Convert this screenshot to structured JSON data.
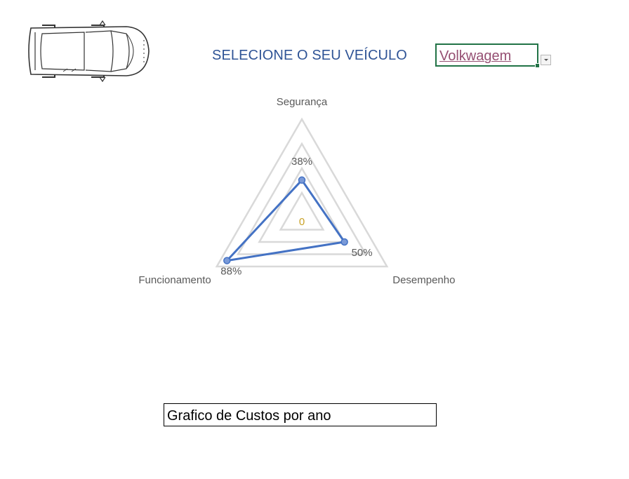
{
  "header": {
    "title": "SELECIONE O SEU VEÍCULO",
    "selected_vehicle": "Volkwagem"
  },
  "icons": {
    "car": "car-top-view-icon",
    "dropdown": "chevron-down-icon"
  },
  "colors": {
    "title": "#2f5496",
    "selected_vehicle": "#954f72",
    "cell_border": "#217346",
    "series_line": "#4472c4",
    "marker_fill": "#7a9ad8",
    "grid": "#d9d9d9",
    "labels": "#595959",
    "center_label": "#c9a227"
  },
  "chart_data": {
    "type": "radar",
    "axes": [
      "Segurança",
      "Desempenho",
      "Funcionamento"
    ],
    "series": [
      {
        "values": [
          0.38,
          0.5,
          0.88
        ],
        "data_labels": [
          "38%",
          "50%",
          "88%"
        ]
      }
    ],
    "range": [
      0,
      1
    ],
    "gridline_levels": 4,
    "center_label": "0",
    "legend": "none"
  },
  "cost_section": {
    "title": "Grafico de Custos por ano"
  }
}
